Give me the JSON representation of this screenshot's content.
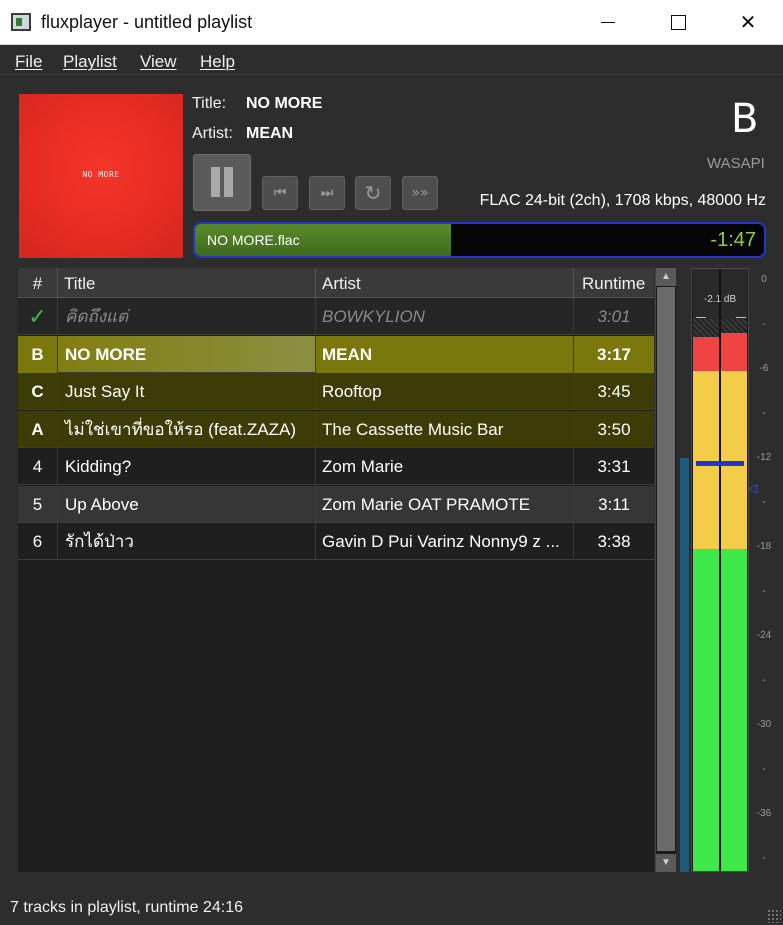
{
  "window": {
    "title": "fluxplayer - untitled playlist"
  },
  "menu": [
    "File",
    "Playlist",
    "View",
    "Help"
  ],
  "now_playing": {
    "cover_text": "NO MORE",
    "title_label": "Title:",
    "title": "NO MORE",
    "artist_label": "Artist:",
    "artist": "MEAN",
    "queue_letter": "B",
    "output": "WASAPI",
    "format": "FLAC 24-bit (2ch), 1708 kbps, 48000 Hz",
    "file": "NO MORE.flac",
    "remaining": "-1:47",
    "progress_fraction": 0.45
  },
  "controls": {
    "pause_icon": "pause-icon",
    "prev_icon": "skip-previous-icon",
    "next_icon": "skip-next-icon",
    "repeat_icon": "repeat-icon",
    "fastforward_icon": "fast-forward-icon"
  },
  "playlist": {
    "headers": {
      "num": "#",
      "title": "Title",
      "artist": "Artist",
      "runtime": "Runtime"
    },
    "rows": [
      {
        "num": "",
        "state": "played",
        "title": "คิดถึงแต่",
        "artist": "BOWKYLION",
        "runtime": "3:01"
      },
      {
        "num": "B",
        "state": "current",
        "title": "NO MORE",
        "artist": "MEAN",
        "runtime": "3:17"
      },
      {
        "num": "C",
        "state": "queued",
        "title": "Just Say It",
        "artist": "Rooftop",
        "runtime": "3:45"
      },
      {
        "num": "A",
        "state": "queued",
        "title": "ไม่ใช่เขาที่ขอให้รอ (feat.ZAZA)",
        "artist": "The Cassette Music Bar",
        "runtime": "3:50"
      },
      {
        "num": "4",
        "state": "normal",
        "title": "Kidding?",
        "artist": "Zom Marie",
        "runtime": "3:31"
      },
      {
        "num": "5",
        "state": "hover",
        "title": "Up Above",
        "artist": "Zom Marie OAT PRAMOTE",
        "runtime": "3:11"
      },
      {
        "num": "6",
        "state": "normal",
        "title": "รักได้ป่าว",
        "artist": "Gavin D Pui Varinz Nonny9 z ...",
        "runtime": "3:38"
      }
    ]
  },
  "vu": {
    "peak_db": "-2.1 dB",
    "scale": [
      "0",
      "-",
      "-6",
      "-",
      "-12",
      "-",
      "-18",
      "-",
      "-24",
      "-",
      "-30",
      "-",
      "-36",
      "-"
    ]
  },
  "status": {
    "text": "7 tracks in playlist, runtime 24:16"
  },
  "colors": {
    "current_row": "#7a780c",
    "queued_row": "#3d3b06",
    "progress_fill": "#4a7a24",
    "progress_border": "#2138c9",
    "remaining_time": "#8fd13a"
  }
}
